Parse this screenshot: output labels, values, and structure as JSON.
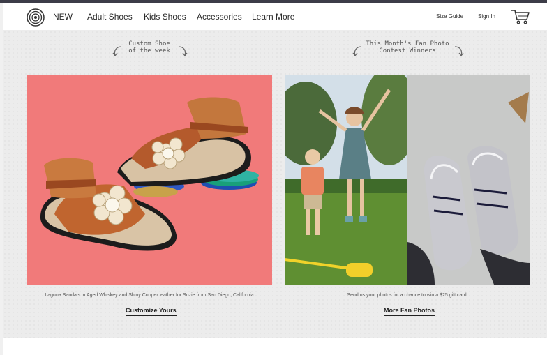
{
  "header": {
    "logo_icon": "spiral-logo-icon",
    "nav": [
      "NEW",
      "Adult Shoes",
      "Kids Shoes",
      "Accessories",
      "Learn More"
    ],
    "size_guide": "Size Guide",
    "sign_in": "Sign In",
    "cart_icon": "shopping-cart-icon"
  },
  "feature_left": {
    "tag_line1": "Custom Shoe",
    "tag_line2": "of the week",
    "image": "sandals-photo",
    "caption": "Laguna Sandals in Aged Whiskey and Shiny Copper leather for Suzie from San Diego, California",
    "cta": "Customize Yours"
  },
  "feature_right": {
    "tag_line1": "This Month's Fan Photo",
    "tag_line2": "Contest Winners",
    "image": "fan-photos",
    "caption": "Send us your photos for a chance to win a $25 gift card!",
    "cta": "More Fan Photos"
  },
  "colors": {
    "topbar": "#3c3c48",
    "background": "#ececec",
    "photo_left_bg": "#f17a7a"
  }
}
